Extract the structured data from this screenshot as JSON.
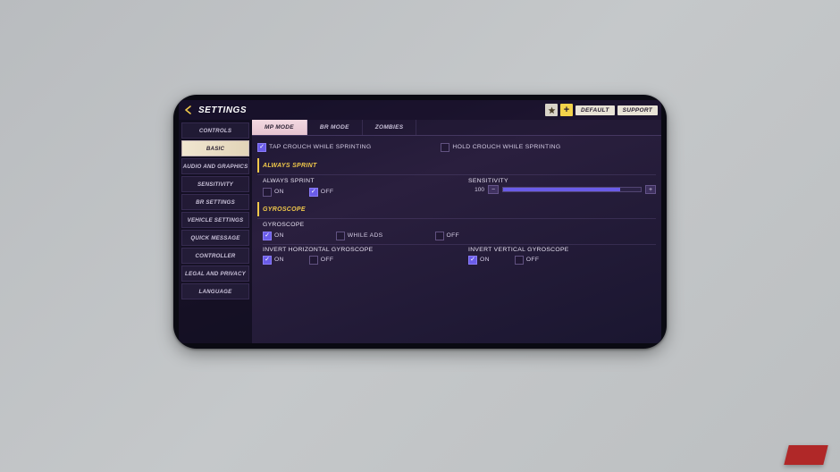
{
  "header": {
    "title": "SETTINGS",
    "plus": "+",
    "default_btn": "DEFAULT",
    "support_btn": "SUPPORT"
  },
  "sidebar": {
    "items": [
      {
        "label": "CONTROLS",
        "active": false
      },
      {
        "label": "BASIC",
        "active": true
      },
      {
        "label": "AUDIO AND GRAPHICS",
        "active": false
      },
      {
        "label": "SENSITIVITY",
        "active": false
      },
      {
        "label": "BR SETTINGS",
        "active": false
      },
      {
        "label": "VEHICLE SETTINGS",
        "active": false
      },
      {
        "label": "QUICK MESSAGE",
        "active": false
      },
      {
        "label": "CONTROLLER",
        "active": false
      },
      {
        "label": "LEGAL AND PRIVACY",
        "active": false
      },
      {
        "label": "LANGUAGE",
        "active": false
      }
    ]
  },
  "tabs": [
    {
      "label": "MP MODE",
      "active": true
    },
    {
      "label": "BR MODE",
      "active": false
    },
    {
      "label": "ZOMBIES",
      "active": false
    }
  ],
  "crouch": {
    "tap_label": "TAP CROUCH WHILE SPRINTING",
    "tap_checked": true,
    "hold_label": "HOLD CROUCH WHILE SPRINTING",
    "hold_checked": false
  },
  "always_sprint": {
    "header": "ALWAYS SPRINT",
    "label": "ALWAYS SPRINT",
    "on": "ON",
    "off": "OFF",
    "value": "OFF",
    "sensitivity_label": "SENSITIVITY",
    "sensitivity_value": "100"
  },
  "gyroscope": {
    "header": "GYROSCOPE",
    "label": "GYROSCOPE",
    "on": "ON",
    "while_ads": "WHILE ADS",
    "off": "OFF",
    "value": "ON",
    "invert_h_label": "INVERT HORIZONTAL GYROSCOPE",
    "invert_h_value": "ON",
    "invert_v_label": "INVERT VERTICAL GYROSCOPE",
    "invert_v_value": "ON",
    "inv_on": "ON",
    "inv_off": "OFF"
  }
}
